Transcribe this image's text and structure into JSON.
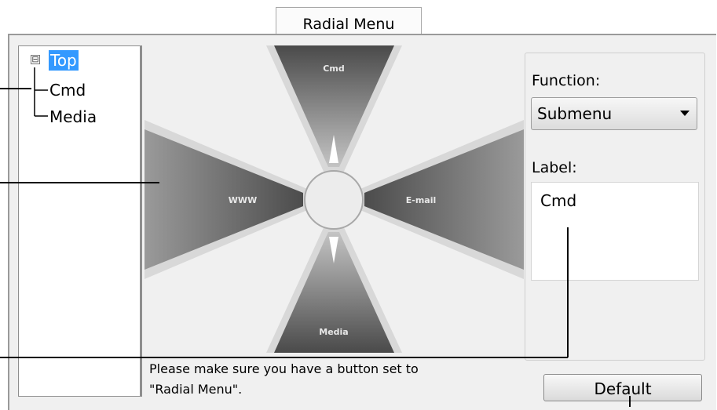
{
  "tab": {
    "title": "Radial Menu"
  },
  "tree": {
    "expander": "⊟",
    "items": [
      {
        "label": "Top",
        "selected": true
      },
      {
        "label": "Cmd"
      },
      {
        "label": "Media"
      }
    ]
  },
  "radial": {
    "top": "Cmd",
    "left": "WWW",
    "right": "E-mail",
    "bottom": "Media"
  },
  "function": {
    "label": "Function:",
    "value": "Submenu"
  },
  "label_field": {
    "label": "Label:",
    "value": "Cmd"
  },
  "note": {
    "line1": "Please make sure you have a button set to",
    "line2": "\"Radial Menu\"."
  },
  "default_button": "Default",
  "colors": {
    "selection": "#3399ff",
    "panel": "#f0f0f0",
    "wedge_dark": "#5a5a5a",
    "wedge_light": "#b8b8b8"
  }
}
